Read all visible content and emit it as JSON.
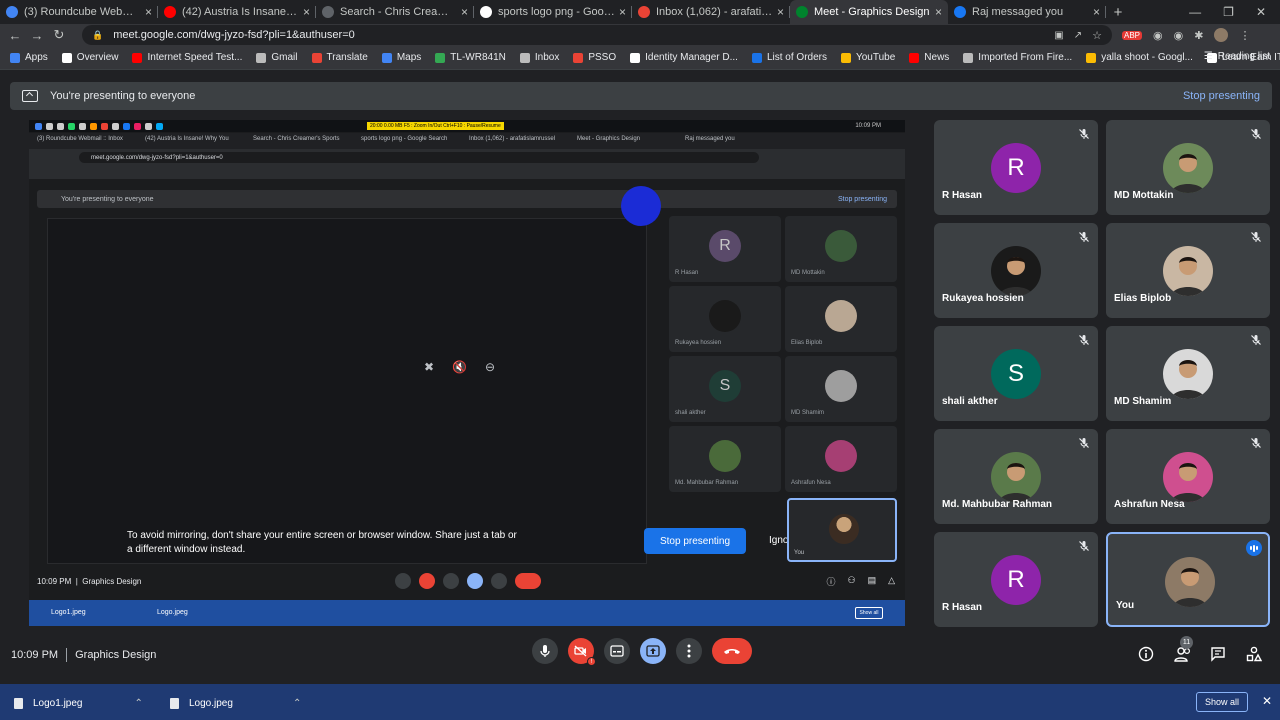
{
  "browser": {
    "tabs": [
      {
        "title": "(3) Roundcube Webmail :: Inbox",
        "color": "#4285f4"
      },
      {
        "title": "(42) Austria Is Insane! Why You",
        "color": "#ff0000"
      },
      {
        "title": "Search - Chris Creamer's Sports",
        "color": "#5f6368"
      },
      {
        "title": "sports logo png - Google Search",
        "color": "#ffffff"
      },
      {
        "title": "Inbox (1,062) - arafatislamrussel",
        "color": "#ea4335"
      },
      {
        "title": "Meet - Graphics Design",
        "color": "#00832d"
      },
      {
        "title": "Raj messaged you",
        "color": "#1877f2"
      }
    ],
    "active_tab_index": 5,
    "url": "meet.google.com/dwg-jyzo-fsd?pli=1&authuser=0",
    "bookmarks": [
      "Apps",
      "Overview",
      "Internet Speed Test...",
      "Gmail",
      "Translate",
      "Maps",
      "TL-WR841N",
      "Inbox",
      "PSSO",
      "Identity Manager D...",
      "List of Orders",
      "YouTube",
      "News",
      "Imported From Fire...",
      "yalla shoot - Googl...",
      "Learn Earn IT GD-1..."
    ],
    "reading_list": "Reading list"
  },
  "meet": {
    "presenting_banner": "You're presenting to everyone",
    "stop_presenting_link": "Stop presenting",
    "shared_screen": {
      "mirror_warning": "To avoid mirroring, don't share your entire screen or browser window. Share just a tab or a different window instead.",
      "stop_presenting_button": "Stop presenting",
      "ignore_button": "Ignore",
      "inner_time": "10:09 PM",
      "inner_meeting": "Graphics Design",
      "inner_you": "You",
      "inner_download_1": "Logo1.jpeg",
      "inner_download_2": "Logo.jpeg",
      "inner_show_all": "Show all",
      "inner_url": "meet.google.com/dwg-jyzo-fsd?pli=1&authuser=0",
      "inner_banner": "You're presenting to everyone",
      "inner_stop": "Stop presenting",
      "taskbar_text": "20:00   0.00 MB   F5 : Zoom In/Out   Ctrl+F10 : Pause/Resume",
      "taskbar_clock": "10:09 PM",
      "inner_tabs": [
        "(3) Roundcube Webmail :: Inbox",
        "(42) Austria Is Insane! Why You",
        "Search - Chris Creamer's Sports",
        "sports logo png - Google Search",
        "Inbox (1,062) - arafatislamrussel",
        "Meet - Graphics Design",
        "Raj messaged you"
      ],
      "inner_participants": [
        "R Hasan",
        "MD Mottakin",
        "Rukayea hossien",
        "Elias Biplob",
        "shali akther",
        "MD Shamim",
        "Md. Mahbubar Rahman",
        "Ashrafun Nesa"
      ]
    },
    "participants": [
      {
        "name": "R Hasan",
        "initial": "R",
        "avatar_color": "#8e24aa"
      },
      {
        "name": "MD Mottakin",
        "initial": "",
        "avatar_color": "#6d8a5a"
      },
      {
        "name": "Rukayea hossien",
        "initial": "",
        "avatar_color": "#1a1a1a"
      },
      {
        "name": "Elias Biplob",
        "initial": "",
        "avatar_color": "#c9b7a3"
      },
      {
        "name": "shali akther",
        "initial": "S",
        "avatar_color": "#00695c"
      },
      {
        "name": "MD Shamim",
        "initial": "",
        "avatar_color": "#d9d9d9"
      },
      {
        "name": "Md. Mahbubar Rahman",
        "initial": "",
        "avatar_color": "#5a7a4a"
      },
      {
        "name": "Ashrafun Nesa",
        "initial": "",
        "avatar_color": "#cf4f8f"
      },
      {
        "name": "R Hasan",
        "initial": "R",
        "avatar_color": "#8e24aa"
      },
      {
        "name": "You",
        "initial": "",
        "avatar_color": "#8d7a66"
      }
    ],
    "footer": {
      "time": "10:09 PM",
      "meeting_name": "Graphics Design",
      "participant_count": "11"
    }
  },
  "downloads": {
    "items": [
      "Logo1.jpeg",
      "Logo.jpeg"
    ],
    "show_all": "Show all"
  }
}
